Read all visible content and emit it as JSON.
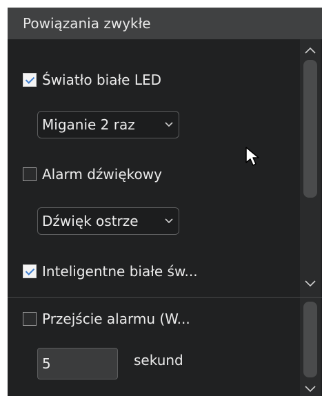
{
  "header": {
    "title": "Powiązania zwykłe"
  },
  "top_section": {
    "led": {
      "label": "Światło białe LED",
      "checked": true
    },
    "led_mode": {
      "value": "Miganie 2 raz"
    },
    "alarm_sound": {
      "label": "Alarm dźwiękowy",
      "checked": false
    },
    "sound_type": {
      "value": "Dźwięk ostrze"
    },
    "smart_light": {
      "label": "Inteligentne białe św...",
      "checked": true
    }
  },
  "bottom_section": {
    "alarm_transition": {
      "label": "Przejście alarmu (W...",
      "checked": false
    },
    "duration": {
      "value": "5",
      "unit": "sekund"
    }
  },
  "colors": {
    "accent": "#3f7fd0",
    "panel": "#202122",
    "header": "#404142"
  },
  "icons": {
    "check": "check-icon",
    "chevron_down": "chevron-down-icon",
    "chevron_up": "chevron-up-icon",
    "cursor": "cursor-arrow-icon"
  }
}
